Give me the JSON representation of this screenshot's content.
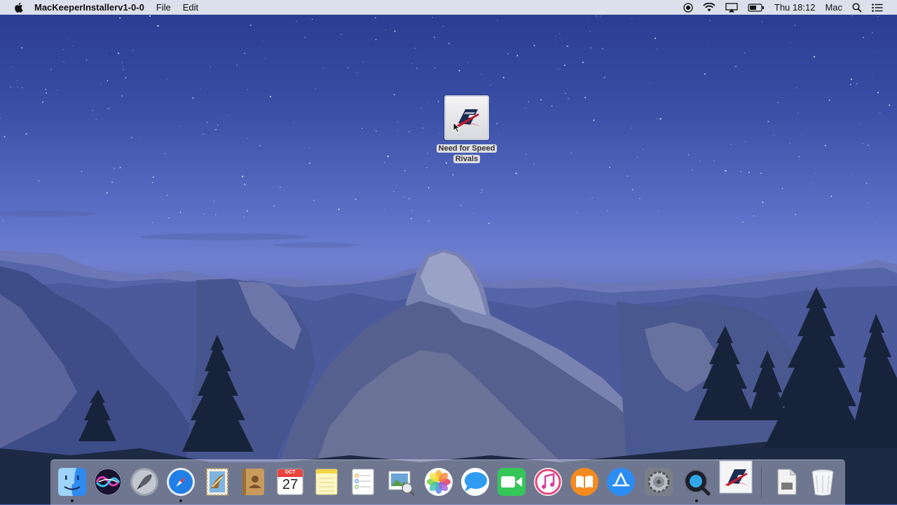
{
  "menubar": {
    "apple_icon": "apple-logo-icon",
    "app_name": "MacKeeperInstallerv1-0-0",
    "menus": [
      "File",
      "Edit"
    ],
    "status": {
      "record_icon": "record-icon",
      "wifi_icon": "wifi-icon",
      "airplay_icon": "airplay-icon",
      "battery_icon": "battery-icon",
      "clock": "Thu 18:12",
      "user": "Mac",
      "spotlight_icon": "spotlight-search-icon",
      "notification_icon": "notification-center-icon"
    }
  },
  "desktop": {
    "icon": {
      "label_line1": "Need for Speed",
      "label_line2": "Rivals",
      "icon_name": "need-for-speed-app-icon"
    }
  },
  "dock": {
    "apps": [
      {
        "name": "Finder",
        "icon": "finder-icon",
        "running": true
      },
      {
        "name": "Siri",
        "icon": "siri-icon",
        "running": false
      },
      {
        "name": "Launchpad",
        "icon": "launchpad-rocket-icon",
        "running": false
      },
      {
        "name": "Safari",
        "icon": "safari-compass-icon",
        "running": true
      },
      {
        "name": "Mail",
        "icon": "mail-stamp-icon",
        "running": false
      },
      {
        "name": "Contacts",
        "icon": "contacts-book-icon",
        "running": false
      },
      {
        "name": "Calendar",
        "icon": "calendar-icon",
        "running": false,
        "month": "OCT",
        "day": "27"
      },
      {
        "name": "Notes",
        "icon": "notes-icon",
        "running": false
      },
      {
        "name": "Reminders",
        "icon": "reminders-icon",
        "running": false
      },
      {
        "name": "Preview",
        "icon": "preview-icon",
        "running": false
      },
      {
        "name": "Photos",
        "icon": "photos-icon",
        "running": false
      },
      {
        "name": "Messages",
        "icon": "messages-icon",
        "running": false
      },
      {
        "name": "FaceTime",
        "icon": "facetime-icon",
        "running": false
      },
      {
        "name": "iTunes",
        "icon": "itunes-icon",
        "running": false
      },
      {
        "name": "iBooks",
        "icon": "ibooks-icon",
        "running": false
      },
      {
        "name": "App Store",
        "icon": "app-store-icon",
        "running": false
      },
      {
        "name": "System Preferences",
        "icon": "system-preferences-gear-icon",
        "running": false
      },
      {
        "name": "QuickTime Player",
        "icon": "quicktime-icon",
        "running": true
      },
      {
        "name": "Need for Speed Rivals",
        "icon": "need-for-speed-app-icon",
        "running": false
      }
    ],
    "others": [
      {
        "name": "Downloads",
        "icon": "downloads-file-icon"
      },
      {
        "name": "Trash",
        "icon": "trash-icon"
      }
    ]
  }
}
